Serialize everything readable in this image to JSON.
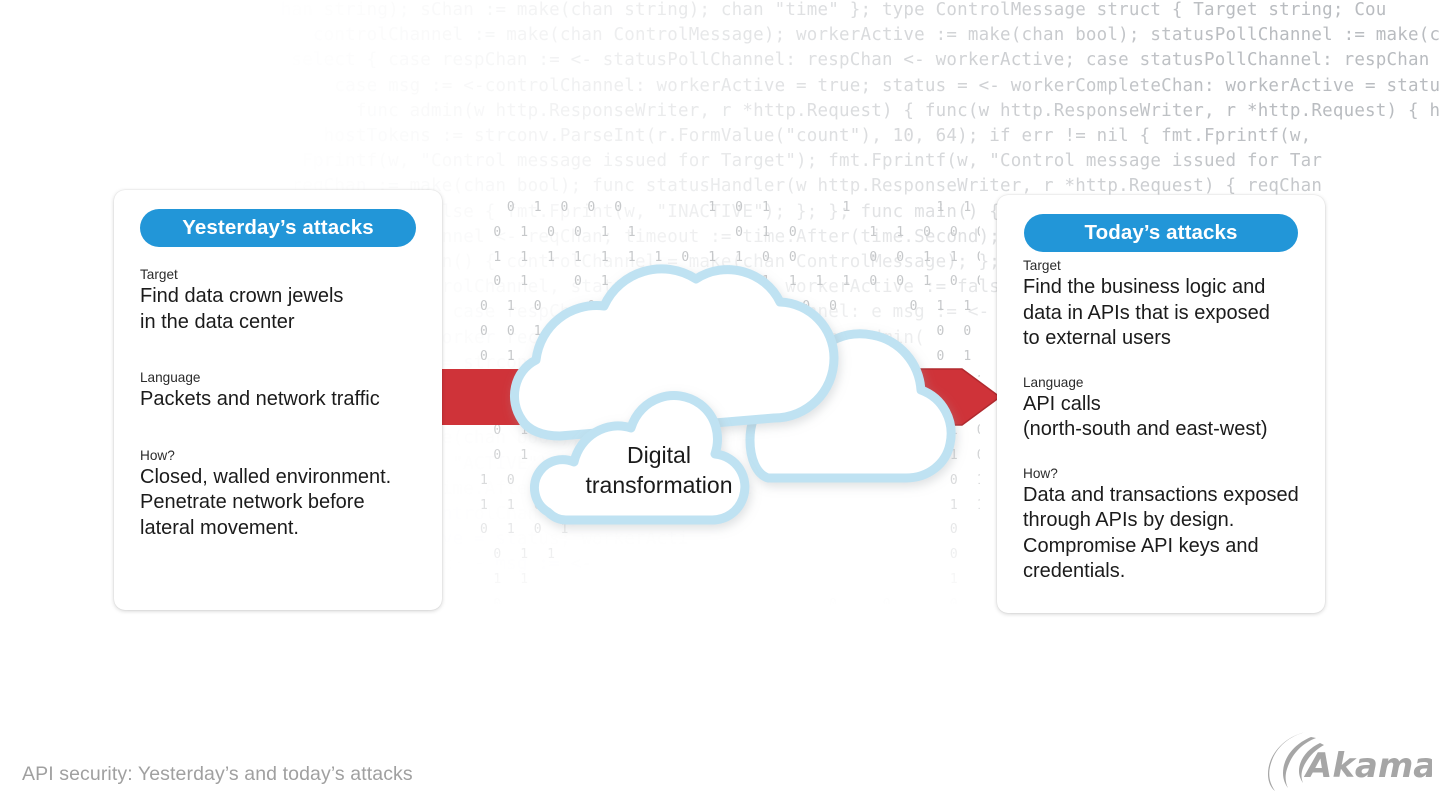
{
  "slide": {
    "footer_caption": "API security: Yesterday’s and today’s attacks",
    "logo_name": "Akamai",
    "background_color": "#ffffff",
    "accent_blue": "#2296d8",
    "accent_red": "#cf3339",
    "cloud_outline": "#bfe2f2",
    "muted_text": "#a0a0a0"
  },
  "center": {
    "cloud_label": "Digital\ntransformation",
    "binary_digits": "  0 1 0 0 0      1 0 1     1      1 1 1 0              1 0   0\n 0 1 0 0 1 1       0 1 0     1 1 0 0 0 0 1 0 1       0   0 0 1 1\n 1 1 1 1 1 1 1 0 1 1 0 0     0 0 1 1 0 0 1 1 0       0 0 0 1 1 0\n 0 1   0 1 0 0 0 0 0 1 1 1 1 0 0 1 0 0 1 0 0 1       0 1 1 0 0 1 1\n0 1 0   0 0 1 1 1 0 0 1 0 0     0 1 1 0 1 1 0 1 0 0 0 1 1 0\n0 0 1   1 1 1 0 0 0 1 0 1         0 0 0 0 0 1   0 1 0 0 0 0\n0 1 0   0 0 0 1 1 1 1 0           0 1 1 0 1   1 1 1 1 1 0\n 1 1   0 1 0 0 1 0               0 0 1 1 0 1 0 1 1 0 1 0 1\n 1 1   0 0 1 1 1 1               0 0 1 1 1 0 1 1 1 1 0 1\n 0 1     0 1 0 1                 1 1 0 1 0 0 1 0 1 0 1 1\n 0 1     1 1 0                   0 1 0 1 1 0 1 1 0 0 1 0\n1 0 1                              0 1 1 0 1 1 1 0 1 1 1\n1 1 0 1                            1 1 0 0 1 0 1 0 1 1 0\n0 1 0 1                            0   1 1 0 0   0 0 0   0\n 0 1 1                             0     0 0     0 0 1   1\n 1 1                               1     1       1 1 0\n 0                        0   0    0     1       1 0 0\n 0                        1   1    1     1       1 1\n 0                        0   1    1     0       1 1\n                              0    1             1\n                                   0"
  },
  "cards": [
    {
      "id": "yesterday",
      "title": "Yesterday’s attacks",
      "fields": [
        {
          "label": "Target",
          "value": "Find data crown jewels\nin the data center"
        },
        {
          "label": "Language",
          "value": "Packets and network traffic"
        },
        {
          "label": "How?",
          "value": "Closed, walled environment.\nPenetrate network before\nlateral movement."
        }
      ]
    },
    {
      "id": "today",
      "title": "Today’s attacks",
      "fields": [
        {
          "label": "Target",
          "value": "Find the business logic and\ndata in APIs that is exposed\nto external users"
        },
        {
          "label": "Language",
          "value": "API calls\n(north-south and east-west)"
        },
        {
          "label": "How?",
          "value": "Data and transactions exposed\nthrough APIs by design.\nCompromise API keys and\ncredentials."
        }
      ]
    }
  ],
  "background_code": "chan string); sChan := make(chan string); chan \"time\" }; type ControlMessage struct { Target string; Cou\n    controlChannel := make(chan ControlMessage); workerActive := make(chan bool); statusPollChannel := make(chan chan bool); w\n  select { case respChan := <- statusPollChannel: respChan <- workerActive; case statusPollChannel: respChan <- workerActive; case\n      case msg := <-controlChannel: workerActive = true; status = <- workerCompleteChan: workerActive = status;\n        func admin(w http.ResponseWriter, r *http.Request) { func(w http.ResponseWriter, r *http.Request) { hostToken\n     hostTokens := strconv.ParseInt(r.FormValue(\"count\"), 10, 64); if err != nil { fmt.Fprintf(w,\n   Fprintf(w, \"Control message issued for Target\"); fmt.Fprintf(w, \"Control message issued for Tar\n  reqChan := make(chan bool); func statusHandler(w http.ResponseWriter, r *http.Request) { reqChan\n   \"ACTIVE\"; } else { fmt.Fprint(w, \"INACTIVE\"); }; }; func main() { , \"ACTIVE\"\n   statusPollChannel <- reqChan; timeout := time.After(time.Second); il)); };pac\n     }; func main() { controlChannel = make(chan ControlMessage); }; func ma\n   go admin(controlChannel, statusPollChannel); workerActive := false; workerActi\n  for { select { case respChan := <- statusPollChannel: e msg := <-\n   fmt.Printf(\"Worker received control message\"); func admin(\n    hostTokens := strconv.ParseInt(r.FormValue); ostTokens\n   if err != nil { fmt.Fprintf(w, \"Error\"); Fprintf(w,\n    message issued for Target, Count ; ued for Tar\n  reqChan := make(chan bool); reqChan\n   fmt.Fprint(w, \"ACTIVE\"); \"ACTIVE\"\n    timeout := time.After(time.Second); }.pol\n     go admin(controlChannel); func mai\n      workerActive = status; workerActi\n       select { case msg := <-"
}
